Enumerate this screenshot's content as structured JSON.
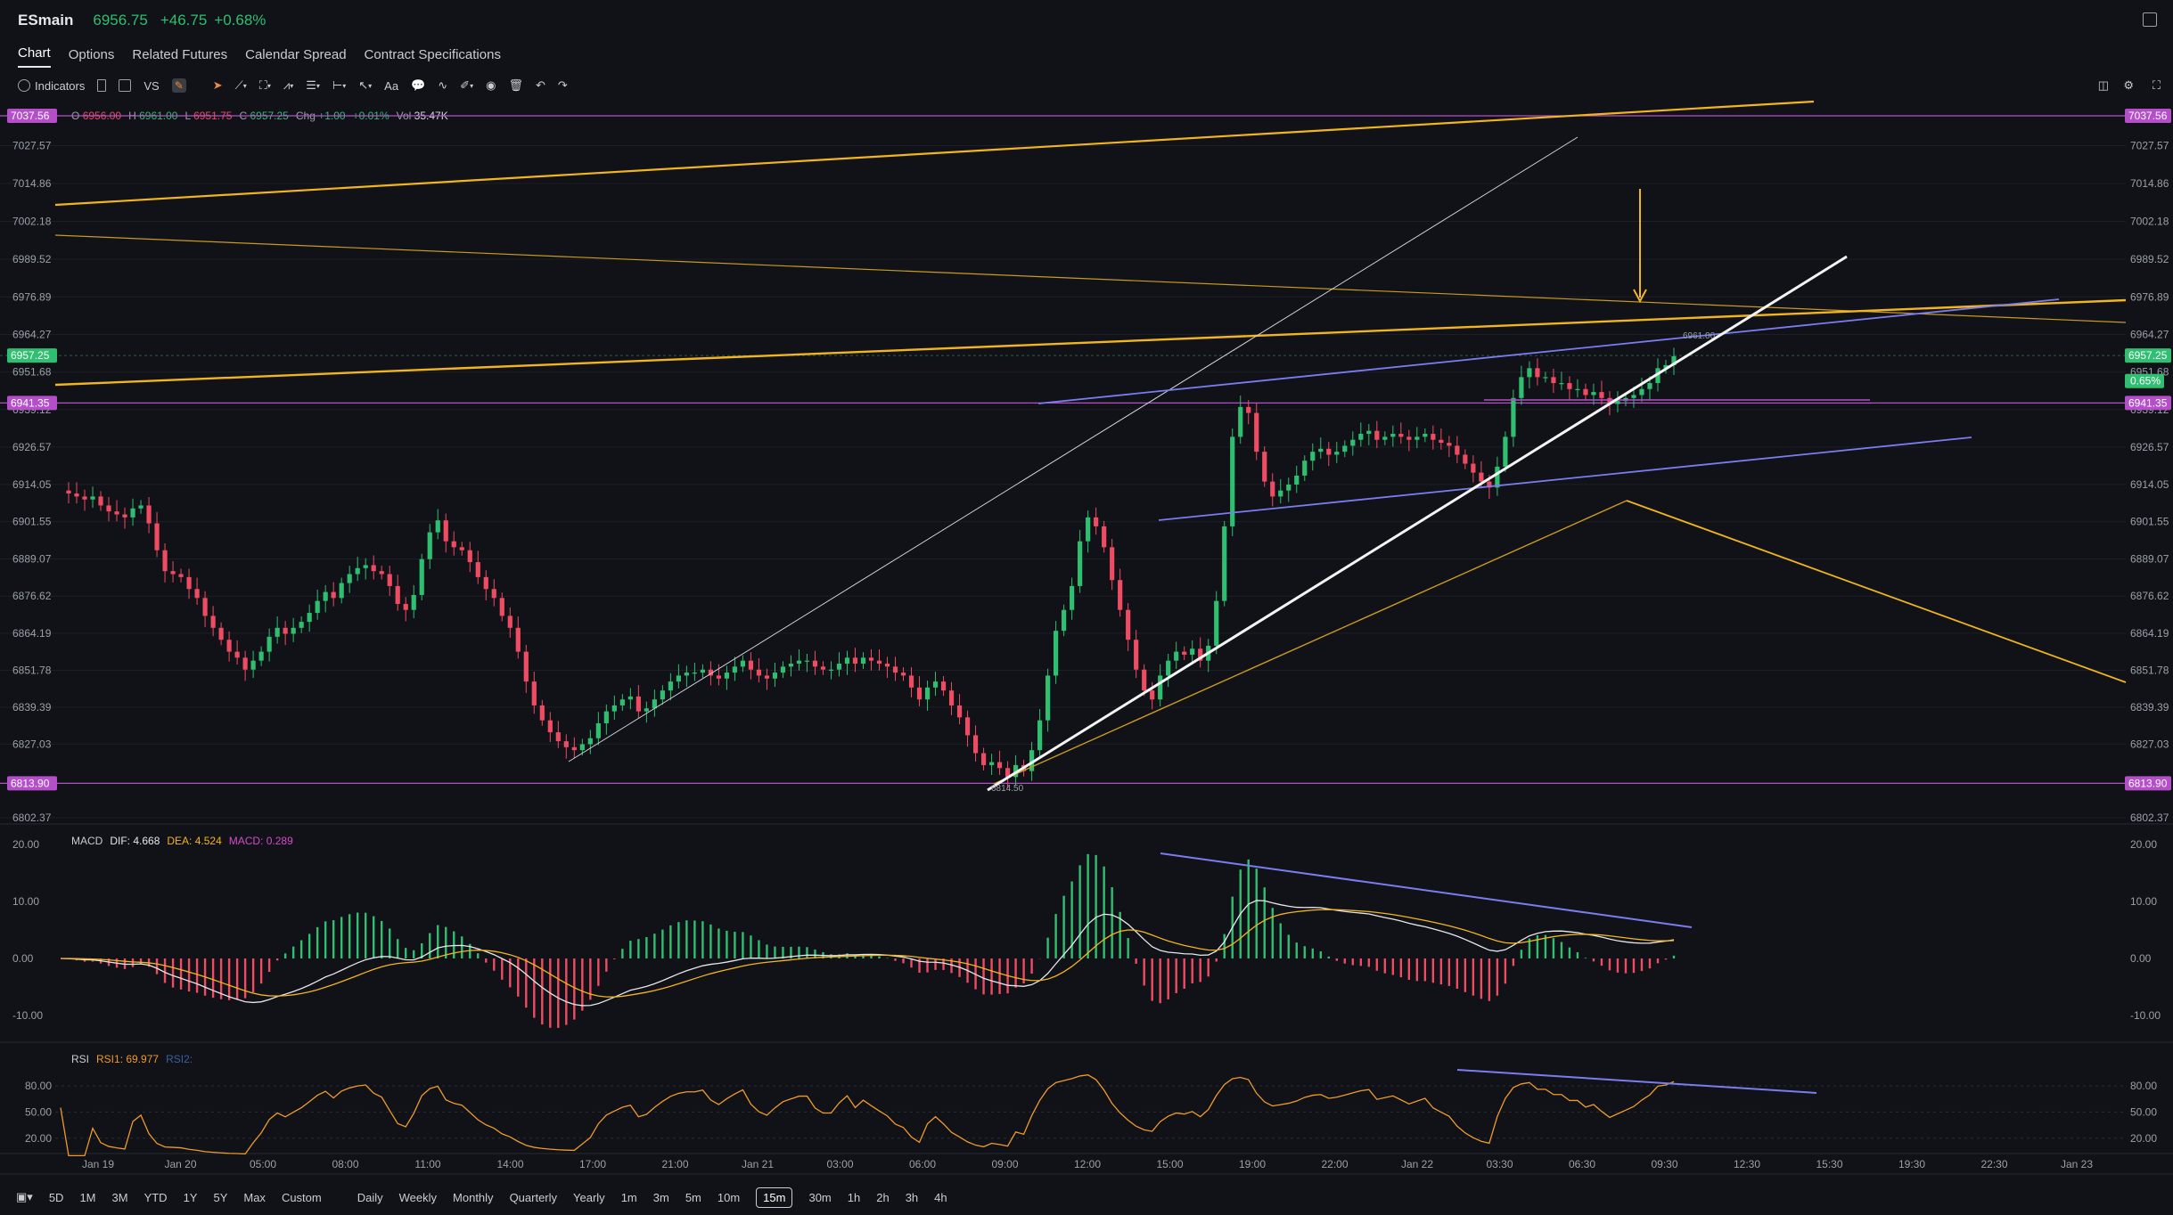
{
  "header": {
    "symbol": "ESmain",
    "price": "6956.75",
    "change": "+46.75",
    "change_pct": "+0.68%"
  },
  "tabs": [
    {
      "label": "Chart",
      "active": true
    },
    {
      "label": "Options"
    },
    {
      "label": "Related Futures"
    },
    {
      "label": "Calendar Spread"
    },
    {
      "label": "Contract Specifications"
    }
  ],
  "toolbar": {
    "indicators_label": "Indicators",
    "vs_label": "VS",
    "aa_label": "Aa"
  },
  "ohlc": {
    "o_label": "O",
    "o": "6956.00",
    "h_label": "H",
    "h": "6961.00",
    "l_label": "L",
    "l": "6951.75",
    "c_label": "C",
    "c": "6957.25",
    "chg_label": "Chg",
    "chg": "+1.00",
    "chg_pct": "+0.01%",
    "vol_label": "Vol",
    "vol": "35.47K"
  },
  "price_axis": {
    "ticks": [
      "7027.57",
      "7014.86",
      "7002.18",
      "6989.52",
      "6976.89",
      "6964.27",
      "6951.68",
      "6939.12",
      "6926.57",
      "6914.05",
      "6901.55",
      "6889.07",
      "6876.62",
      "6864.19",
      "6851.78",
      "6839.39",
      "6827.03",
      "6802.37"
    ],
    "tags": [
      {
        "value": "7037.56",
        "color": "#b44fc9"
      },
      {
        "value": "6957.25",
        "color": "#2fbf71"
      },
      {
        "value": "6941.35",
        "color": "#b44fc9"
      },
      {
        "value": "6813.90",
        "color": "#b44fc9"
      }
    ],
    "right_pct": "0.65%"
  },
  "annotations": {
    "low_label": "6814.50",
    "high_label": "6961.00"
  },
  "macd": {
    "name": "MACD",
    "dif": "DIF: 4.668",
    "dea": "DEA: 4.524",
    "macd": "MACD: 0.289",
    "ticks": [
      "20.00",
      "10.00",
      "0.00",
      "-10.00"
    ]
  },
  "rsi": {
    "name": "RSI",
    "rsi1": "RSI1: 69.977",
    "rsi2": "RSI2:",
    "ticks": [
      "80.00",
      "50.00",
      "20.00"
    ]
  },
  "time_axis": [
    "Jan 19",
    "Jan 20",
    "05:00",
    "08:00",
    "11:00",
    "14:00",
    "17:00",
    "21:00",
    "Jan 21",
    "03:00",
    "06:00",
    "09:00",
    "12:00",
    "15:00",
    "19:00",
    "22:00",
    "Jan 22",
    "03:30",
    "06:30",
    "09:30",
    "12:30",
    "15:30",
    "19:30",
    "22:30",
    "Jan 23"
  ],
  "ranges": [
    "5D",
    "1M",
    "3M",
    "YTD",
    "1Y",
    "5Y",
    "Max",
    "Custom"
  ],
  "periods": [
    "Daily",
    "Weekly",
    "Monthly",
    "Quarterly",
    "Yearly",
    "1m",
    "3m",
    "5m",
    "10m",
    "15m",
    "30m",
    "1h",
    "2h",
    "3h",
    "4h"
  ],
  "active_period": "15m",
  "colors": {
    "up": "#2fbf71",
    "down": "#ef4b63",
    "accent_yellow": "#f2b51d",
    "trend_blue": "#7b7cf0",
    "level_purple": "#b44fc9"
  },
  "price_series": [
    6912,
    6911,
    6910,
    6909,
    6910,
    6907,
    6905,
    6904,
    6903,
    6906,
    6907,
    6901,
    6892,
    6885,
    6884,
    6883,
    6879,
    6876,
    6870,
    6866,
    6862,
    6858,
    6856,
    6852,
    6855,
    6858,
    6863,
    6866,
    6864,
    6866,
    6868,
    6871,
    6875,
    6878,
    6876,
    6881,
    6884,
    6886,
    6887,
    6885,
    6884,
    6880,
    6874,
    6872,
    6877,
    6889,
    6898,
    6902,
    6895,
    6893,
    6892,
    6888,
    6883,
    6879,
    6876,
    6870,
    6866,
    6858,
    6848,
    6840,
    6835,
    6831,
    6828,
    6826,
    6825,
    6827,
    6829,
    6834,
    6838,
    6840,
    6842,
    6843,
    6838,
    6839,
    6842,
    6845,
    6848,
    6850,
    6851,
    6851,
    6852,
    6850,
    6849,
    6851,
    6853,
    6855,
    6852,
    6850,
    6849,
    6851,
    6853,
    6854,
    6855,
    6855,
    6853,
    6852,
    6852,
    6854,
    6856,
    6854,
    6856,
    6855,
    6854,
    6853,
    6851,
    6850,
    6846,
    6842,
    6846,
    6848,
    6845,
    6840,
    6836,
    6830,
    6824,
    6820,
    6821,
    6819,
    6816,
    6820,
    6818,
    6825,
    6835,
    6850,
    6865,
    6872,
    6880,
    6895,
    6903,
    6900,
    6893,
    6882,
    6872,
    6862,
    6852,
    6845,
    6842,
    6850,
    6855,
    6858,
    6857,
    6859,
    6855,
    6860,
    6875,
    6900,
    6930,
    6940,
    6938,
    6925,
    6915,
    6910,
    6912,
    6914,
    6917,
    6922,
    6925,
    6926,
    6924,
    6925,
    6927,
    6929,
    6931,
    6932,
    6929,
    6930,
    6931,
    6930,
    6929,
    6930,
    6931,
    6929,
    6928,
    6927,
    6924,
    6921,
    6918,
    6915,
    6913,
    6920,
    6930,
    6943,
    6950,
    6953,
    6950,
    6950,
    6948,
    6948,
    6946,
    6946,
    6944,
    6945,
    6943,
    6941,
    6942,
    6943,
    6944,
    6946,
    6948,
    6953,
    6954,
    6957
  ]
}
